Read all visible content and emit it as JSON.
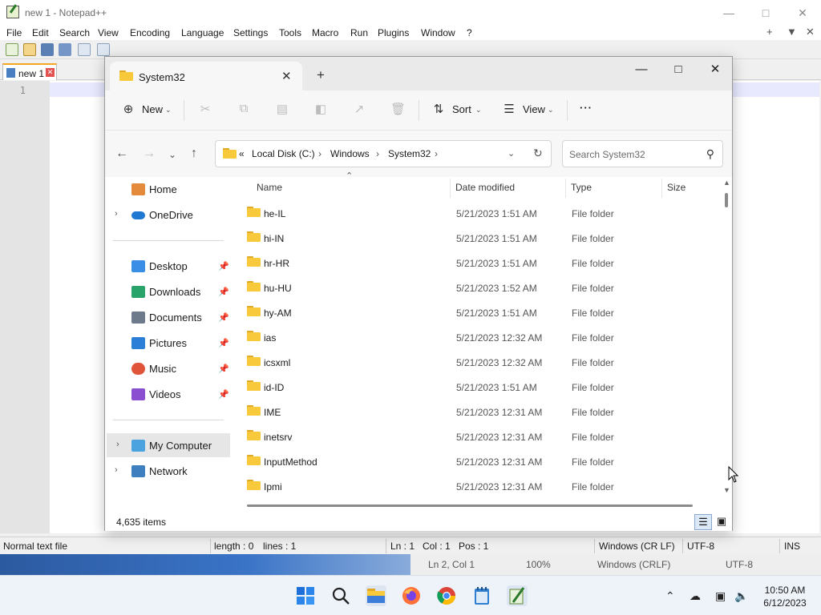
{
  "npp": {
    "title": "new 1 - Notepad++",
    "menu": [
      "File",
      "Edit",
      "Search",
      "View",
      "Encoding",
      "Language",
      "Settings",
      "Tools",
      "Macro",
      "Run",
      "Plugins",
      "Window",
      "?"
    ],
    "menu_right": [
      "+",
      "▼",
      "✕"
    ],
    "tab_label": "new 1",
    "line_number": "1",
    "status": {
      "file_type": "Normal text file",
      "length": "length : 0",
      "lines": "lines : 1",
      "ln": "Ln : 1",
      "col": "Col : 1",
      "pos": "Pos : 1",
      "eol": "Windows (CR LF)",
      "encoding": "UTF-8",
      "mode": "INS"
    }
  },
  "ghost_status": {
    "pos": "Ln 2, Col 1",
    "zoom": "100%",
    "eol": "Windows (CRLF)",
    "encoding": "UTF-8"
  },
  "explorer": {
    "tab_title": "System32",
    "commands": {
      "new": "New",
      "sort": "Sort",
      "view": "View",
      "more": "···"
    },
    "breadcrumb": {
      "overflow": "«",
      "items": [
        "Local Disk (C:)",
        "Windows",
        "System32"
      ]
    },
    "search_placeholder": "Search System32",
    "nav": {
      "home": "Home",
      "onedrive": "OneDrive",
      "quick": [
        {
          "label": "Desktop",
          "color": "#3a8ee6"
        },
        {
          "label": "Downloads",
          "color": "#2aa36b"
        },
        {
          "label": "Documents",
          "color": "#6d7a8c"
        },
        {
          "label": "Pictures",
          "color": "#2b7fd6"
        },
        {
          "label": "Music",
          "color": "#e0553a"
        },
        {
          "label": "Videos",
          "color": "#8a4fd1"
        }
      ],
      "my_computer": "My Computer",
      "network": "Network"
    },
    "columns": [
      "Name",
      "Date modified",
      "Type",
      "Size"
    ],
    "rows": [
      {
        "name": "he-IL",
        "date": "5/21/2023 1:51 AM",
        "type": "File folder"
      },
      {
        "name": "hi-IN",
        "date": "5/21/2023 1:51 AM",
        "type": "File folder"
      },
      {
        "name": "hr-HR",
        "date": "5/21/2023 1:51 AM",
        "type": "File folder"
      },
      {
        "name": "hu-HU",
        "date": "5/21/2023 1:52 AM",
        "type": "File folder"
      },
      {
        "name": "hy-AM",
        "date": "5/21/2023 1:51 AM",
        "type": "File folder"
      },
      {
        "name": "ias",
        "date": "5/21/2023 12:32 AM",
        "type": "File folder"
      },
      {
        "name": "icsxml",
        "date": "5/21/2023 12:32 AM",
        "type": "File folder"
      },
      {
        "name": "id-ID",
        "date": "5/21/2023 1:51 AM",
        "type": "File folder"
      },
      {
        "name": "IME",
        "date": "5/21/2023 12:31 AM",
        "type": "File folder"
      },
      {
        "name": "inetsrv",
        "date": "5/21/2023 12:31 AM",
        "type": "File folder"
      },
      {
        "name": "InputMethod",
        "date": "5/21/2023 12:31 AM",
        "type": "File folder"
      },
      {
        "name": "Ipmi",
        "date": "5/21/2023 12:31 AM",
        "type": "File folder"
      }
    ],
    "item_count": "4,635 items"
  },
  "taskbar": {
    "apps": [
      "start-icon",
      "search-icon",
      "file-explorer-icon",
      "firefox-icon",
      "chrome-icon",
      "notepad-icon",
      "notepadpp-icon"
    ],
    "clock_time": "10:50 AM",
    "clock_date": "6/12/2023"
  }
}
